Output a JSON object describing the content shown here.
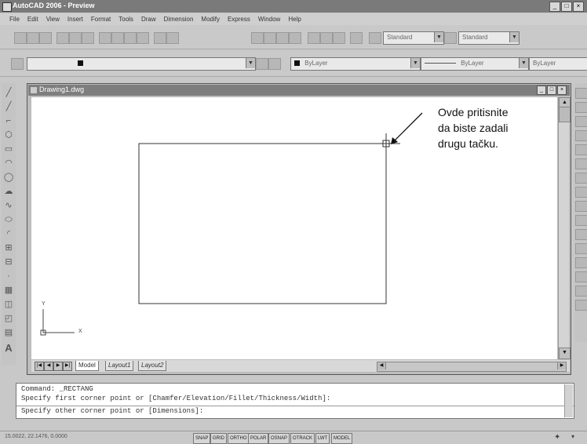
{
  "app": {
    "title": "AutoCAD 2006 - Preview",
    "window_buttons": [
      "_",
      "□",
      "×"
    ]
  },
  "menu": [
    "File",
    "Edit",
    "View",
    "Insert",
    "Format",
    "Tools",
    "Draw",
    "Dimension",
    "Modify",
    "Express",
    "Window",
    "Help"
  ],
  "toolbar": {
    "text_style": "Standard",
    "dim_style": "Standard",
    "color": "ByLayer",
    "linetype": "ByLayer",
    "lineweight": "ByLayer"
  },
  "drawing": {
    "title": "Drawing1.dwg",
    "ucs_y": "Y",
    "ucs_x": "X",
    "callout": [
      "Ovde pritisnite",
      "da biste zadali",
      "drugu tačku."
    ]
  },
  "tabs": [
    "Model",
    "Layout1",
    "Layout2"
  ],
  "command": {
    "lines": [
      "Command:  _RECTANG",
      "Specify first corner point or [Chamfer/Elevation/Fillet/Thickness/Width]:",
      "Specify other corner point or [Dimensions]:"
    ]
  },
  "status": {
    "coords": "15.0022, 22.1476, 0.0000",
    "buttons": [
      "SNAP",
      "GRID",
      "ORTHO",
      "POLAR",
      "OSNAP",
      "OTRACK",
      "LWT",
      "MODEL"
    ]
  }
}
